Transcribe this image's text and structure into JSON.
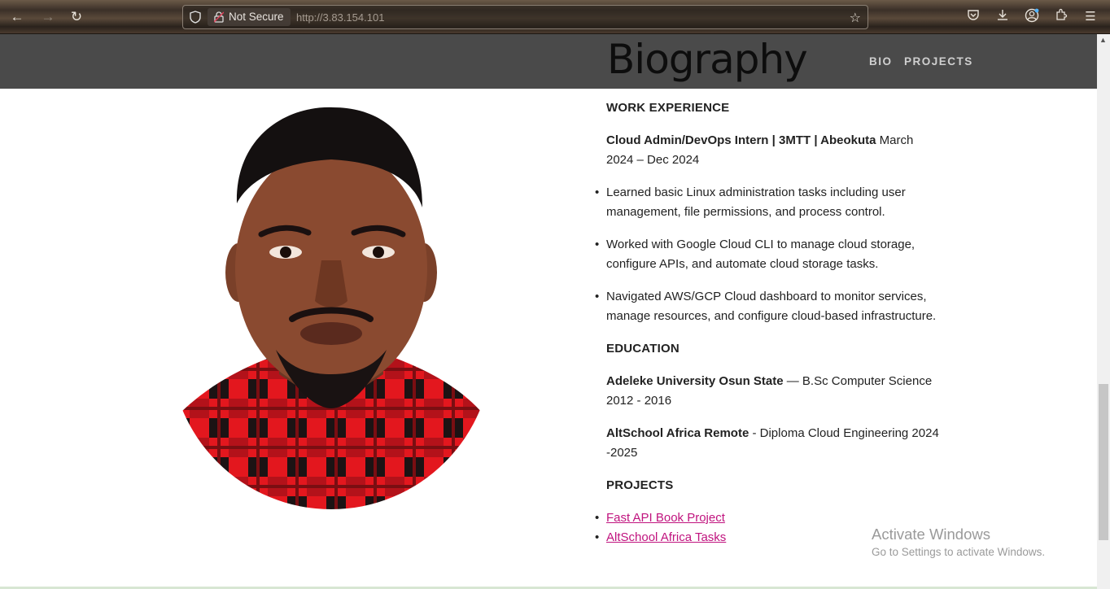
{
  "browser": {
    "security_label": "Not Secure",
    "url": "http://3.83.154.101",
    "icons": [
      "back-icon",
      "forward-icon",
      "reload-icon",
      "shield-icon",
      "lock-icon",
      "star-icon",
      "pocket-icon",
      "download-icon",
      "account-icon",
      "extensions-icon",
      "menu-icon"
    ]
  },
  "header": {
    "brand": "Biography",
    "nav": {
      "bio": "BIO",
      "projects": "PROJECTS"
    }
  },
  "resume": {
    "work_heading": "WORK EXPERIENCE",
    "job_title": "Cloud Admin/DevOps Intern | 3MTT | Abeokuta",
    "job_dates": " March 2024 – Dec 2024",
    "bullets": [
      "Learned basic Linux administration tasks including user management, file permissions, and process control.",
      "Worked with Google Cloud CLI to manage cloud storage, configure APIs, and automate cloud storage tasks.",
      "Navigated AWS/GCP Cloud dashboard to monitor services, manage resources, and configure cloud-based infrastructure."
    ],
    "education_heading": "EDUCATION",
    "edu": [
      {
        "school": "Adeleke University Osun State",
        "detail": " — B.Sc Computer Science 2012 - 2016"
      },
      {
        "school": "AltSchool Africa Remote",
        "detail": " - Diploma Cloud Engineering 2024 -2025"
      }
    ],
    "projects_heading": "PROJECTS",
    "projects": [
      "Fast API Book Project",
      "AltSchool Africa Tasks"
    ]
  },
  "watermark": {
    "title": "Activate Windows",
    "subtitle": "Go to Settings to activate Windows."
  }
}
